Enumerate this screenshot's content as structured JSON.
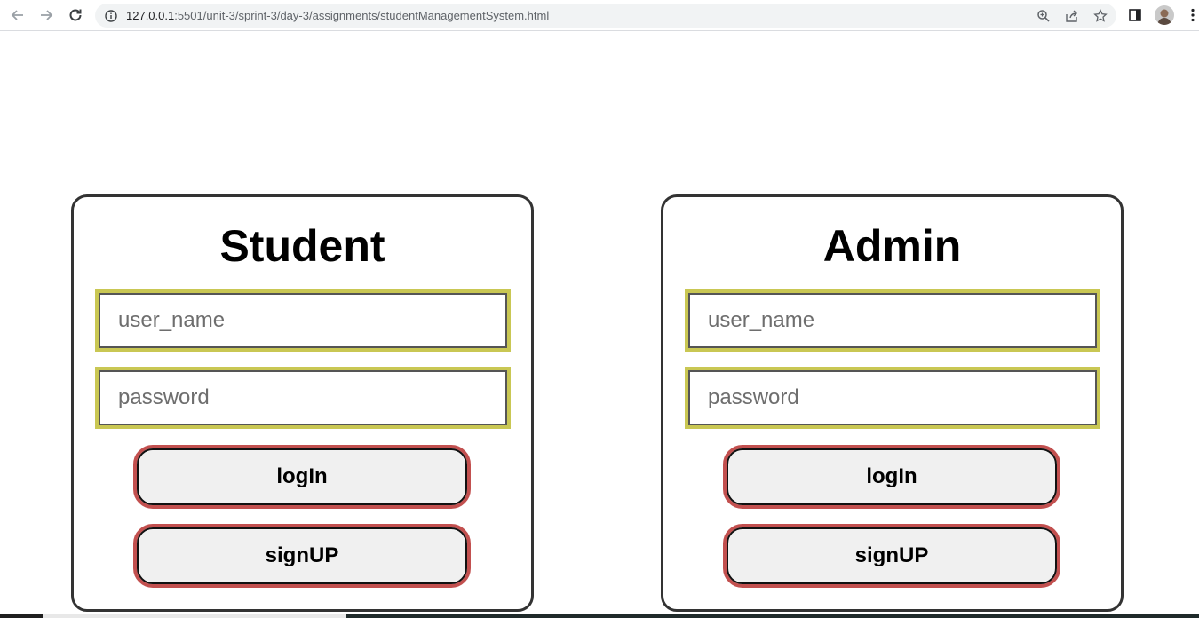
{
  "browser": {
    "url_host": "127.0.0.1",
    "url_path": ":5501/unit-3/sprint-3/day-3/assignments/studentManagementSystem.html"
  },
  "cards": {
    "student": {
      "title": "Student",
      "username_placeholder": "user_name",
      "password_placeholder": "password",
      "login_label": "logIn",
      "signup_label": "signUP"
    },
    "admin": {
      "title": "Admin",
      "username_placeholder": "user_name",
      "password_placeholder": "password",
      "login_label": "logIn",
      "signup_label": "signUP"
    }
  },
  "colors": {
    "input_outline": "#c9c753",
    "button_outline": "#c2504f",
    "button_fill": "#f0f0f0",
    "card_border": "#333333"
  }
}
